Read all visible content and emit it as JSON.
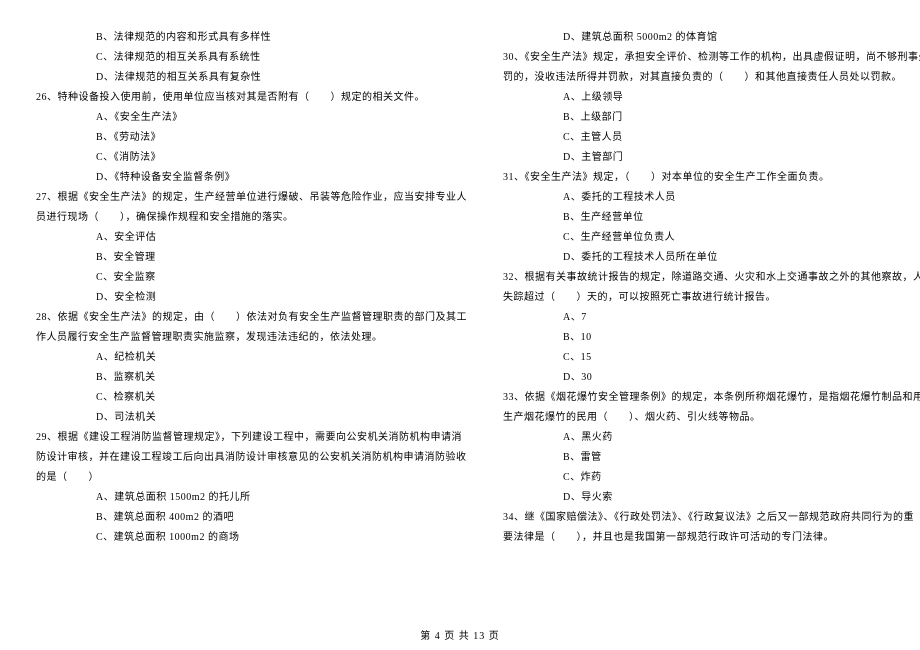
{
  "left": {
    "l1": "B、法律规范的内容和形式具有多样性",
    "l2": "C、法律规范的相互关系具有系统性",
    "l3": "D、法律规范的相互关系具有复杂性",
    "q26": "26、特种设备投入使用前，使用单位应当核对其是否附有（　　）规定的相关文件。",
    "q26a": "A、《安全生产法》",
    "q26b": "B、《劳动法》",
    "q26c": "C、《消防法》",
    "q26d": "D、《特种设备安全监督条例》",
    "q27l1": "27、根据《安全生产法》的规定，生产经营单位进行爆破、吊装等危险作业，应当安排专业人",
    "q27l2": "员进行现场（　　），确保操作规程和安全措施的落实。",
    "q27a": "A、安全评估",
    "q27b": "B、安全管理",
    "q27c": "C、安全监察",
    "q27d": "D、安全检测",
    "q28l1": "28、依据《安全生产法》的规定，由（　　）依法对负有安全生产监督管理职责的部门及其工",
    "q28l2": "作人员履行安全生产监督管理职责实施监察，发现违法违纪的，依法处理。",
    "q28a": "A、纪检机关",
    "q28b": "B、监察机关",
    "q28c": "C、检察机关",
    "q28d": "D、司法机关",
    "q29l1": "29、根据《建设工程消防监督管理规定》，下列建设工程中，需要向公安机关消防机构申请消",
    "q29l2": "防设计审核，并在建设工程竣工后向出具消防设计审核意见的公安机关消防机构申请消防验收",
    "q29l3": "的是（　　）",
    "q29a": "A、建筑总面积 1500m2 的托儿所",
    "q29b": "B、建筑总面积 400m2 的酒吧",
    "q29c": "C、建筑总面积 1000m2 的商场"
  },
  "right": {
    "q29d": "D、建筑总面积 5000m2 的体育馆",
    "q30l1": "30、《安全生产法》规定，承担安全评价、检测等工作的机构，出具虚假证明，尚不够刑事处",
    "q30l2": "罚的，没收违法所得并罚款，对其直接负责的（　　）和其他直接责任人员处以罚款。",
    "q30a": "A、上级领导",
    "q30b": "B、上级部门",
    "q30c": "C、主管人员",
    "q30d": "D、主管部门",
    "q31": "31、《安全生产法》规定，（　　）对本单位的安全生产工作全面负责。",
    "q31a": "A、委托的工程技术人员",
    "q31b": "B、生产经营单位",
    "q31c": "C、生产经营单位负责人",
    "q31d": "D、委托的工程技术人员所在单位",
    "q32l1": "32、根据有关事故统计报告的规定，除道路交通、火灾和水上交通事故之外的其他察故，人员",
    "q32l2": "失踪超过（　　）天的，可以按照死亡事故进行统计报告。",
    "q32a": "A、7",
    "q32b": "B、10",
    "q32c": "C、15",
    "q32d": "D、30",
    "q33l1": "33、依据《烟花爆竹安全管理条例》的规定，本条例所称烟花爆竹，是指烟花爆竹制品和用于",
    "q33l2": "生产烟花爆竹的民用（　　）、烟火药、引火线等物品。",
    "q33a": "A、黑火药",
    "q33b": "B、雷管",
    "q33c": "C、炸药",
    "q33d": "D、导火索",
    "q34l1": "34、继《国家赔偿法》、《行政处罚法》、《行政复议法》之后又一部规范政府共同行为的重",
    "q34l2": "要法律是（　　），并且也是我国第一部规范行政许可活动的专门法律。"
  },
  "footer": "第 4 页 共 13 页"
}
